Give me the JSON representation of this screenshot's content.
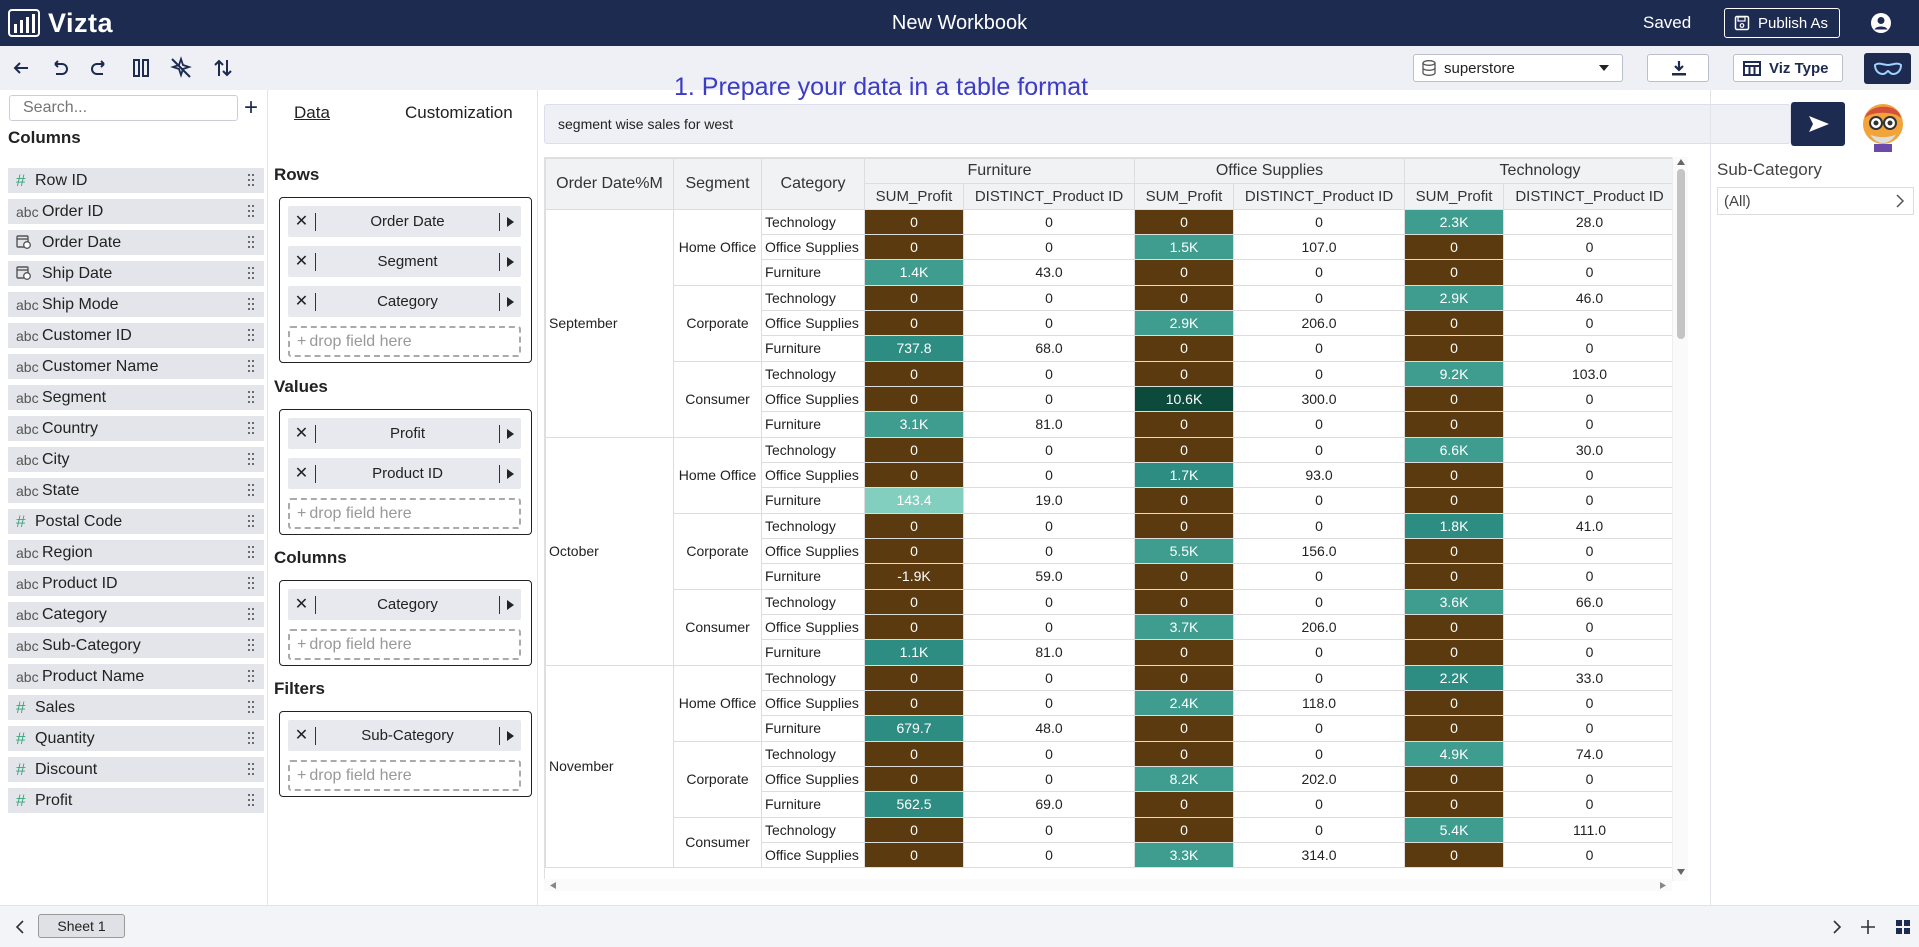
{
  "app": {
    "name": "Vizta",
    "workbook_title": "New Workbook",
    "save_status": "Saved",
    "publish_label": "Publish As"
  },
  "toolbar": {
    "datasource": "superstore",
    "viz_type_label": "Viz Type"
  },
  "colors": {
    "brand": "#1d2b50",
    "heat_negative": "#5a3a0e",
    "heat_low": "#2e8d83",
    "heat_mid": "#3f9d90",
    "heat_high": "#0c4a3c",
    "heat_light": "#82cfc0"
  },
  "left": {
    "search_placeholder": "Search...",
    "columns_title": "Columns",
    "fields": [
      {
        "type": "#",
        "name": "Row ID"
      },
      {
        "type": "abc",
        "name": "Order ID"
      },
      {
        "type": "date",
        "name": "Order Date"
      },
      {
        "type": "date",
        "name": "Ship Date"
      },
      {
        "type": "abc",
        "name": "Ship Mode"
      },
      {
        "type": "abc",
        "name": "Customer ID"
      },
      {
        "type": "abc",
        "name": "Customer Name"
      },
      {
        "type": "abc",
        "name": "Segment"
      },
      {
        "type": "abc",
        "name": "Country"
      },
      {
        "type": "abc",
        "name": "City"
      },
      {
        "type": "abc",
        "name": "State"
      },
      {
        "type": "#",
        "name": "Postal Code"
      },
      {
        "type": "abc",
        "name": "Region"
      },
      {
        "type": "abc",
        "name": "Product ID"
      },
      {
        "type": "abc",
        "name": "Category"
      },
      {
        "type": "abc",
        "name": "Sub-Category"
      },
      {
        "type": "abc",
        "name": "Product Name"
      },
      {
        "type": "#",
        "name": "Sales"
      },
      {
        "type": "#",
        "name": "Quantity"
      },
      {
        "type": "#",
        "name": "Discount"
      },
      {
        "type": "#",
        "name": "Profit"
      }
    ]
  },
  "config": {
    "tab_data": "Data",
    "tab_customization": "Customization",
    "rows_title": "Rows",
    "rows": [
      "Order Date",
      "Segment",
      "Category"
    ],
    "values_title": "Values",
    "values": [
      "Profit",
      "Product ID"
    ],
    "columns_title": "Columns",
    "columns": [
      "Category"
    ],
    "filters_title": "Filters",
    "filters": [
      "Sub-Category"
    ],
    "drop_placeholder": "drop field here",
    "pill_x": "✕"
  },
  "main": {
    "instruction": "1. Prepare your data in a table format",
    "query": "segment wise sales for west"
  },
  "table": {
    "row_headers": [
      "Order Date%M",
      "Segment",
      "Category"
    ],
    "column_groups": [
      "Furniture",
      "Office Supplies",
      "Technology"
    ],
    "value_headers": [
      "SUM_Profit",
      "DISTINCT_Product ID"
    ],
    "months": [
      {
        "name": "September",
        "segments": [
          {
            "name": "Home Office",
            "rows": [
              {
                "cat": "Technology",
                "v": [
                  "0",
                  "0",
                  "0",
                  "0",
                  "2.3K",
                  "28.0"
                ],
                "h": [
                  "n",
                  "",
                  "n",
                  "",
                  "l",
                  ""
                ]
              },
              {
                "cat": "Office Supplies",
                "v": [
                  "0",
                  "0",
                  "1.5K",
                  "107.0",
                  "0",
                  "0"
                ],
                "h": [
                  "n",
                  "",
                  "l",
                  "",
                  "n",
                  ""
                ]
              },
              {
                "cat": "Furniture",
                "v": [
                  "1.4K",
                  "43.0",
                  "0",
                  "0",
                  "0",
                  "0"
                ],
                "h": [
                  "l",
                  "",
                  "n",
                  "",
                  "n",
                  ""
                ]
              }
            ]
          },
          {
            "name": "Corporate",
            "rows": [
              {
                "cat": "Technology",
                "v": [
                  "0",
                  "0",
                  "0",
                  "0",
                  "2.9K",
                  "46.0"
                ],
                "h": [
                  "n",
                  "",
                  "n",
                  "",
                  "l",
                  ""
                ]
              },
              {
                "cat": "Office Supplies",
                "v": [
                  "0",
                  "0",
                  "2.9K",
                  "206.0",
                  "0",
                  "0"
                ],
                "h": [
                  "n",
                  "",
                  "l",
                  "",
                  "n",
                  ""
                ]
              },
              {
                "cat": "Furniture",
                "v": [
                  "737.8",
                  "68.0",
                  "0",
                  "0",
                  "0",
                  "0"
                ],
                "h": [
                  "m",
                  "",
                  "n",
                  "",
                  "n",
                  ""
                ]
              }
            ]
          },
          {
            "name": "Consumer",
            "rows": [
              {
                "cat": "Technology",
                "v": [
                  "0",
                  "0",
                  "0",
                  "0",
                  "9.2K",
                  "103.0"
                ],
                "h": [
                  "n",
                  "",
                  "n",
                  "",
                  "l",
                  ""
                ]
              },
              {
                "cat": "Office Supplies",
                "v": [
                  "0",
                  "0",
                  "10.6K",
                  "300.0",
                  "0",
                  "0"
                ],
                "h": [
                  "n",
                  "",
                  "d",
                  "",
                  "n",
                  ""
                ]
              },
              {
                "cat": "Furniture",
                "v": [
                  "3.1K",
                  "81.0",
                  "0",
                  "0",
                  "0",
                  "0"
                ],
                "h": [
                  "l",
                  "",
                  "n",
                  "",
                  "n",
                  ""
                ]
              }
            ]
          }
        ]
      },
      {
        "name": "October",
        "segments": [
          {
            "name": "Home Office",
            "rows": [
              {
                "cat": "Technology",
                "v": [
                  "0",
                  "0",
                  "0",
                  "0",
                  "6.6K",
                  "30.0"
                ],
                "h": [
                  "n",
                  "",
                  "n",
                  "",
                  "l",
                  ""
                ]
              },
              {
                "cat": "Office Supplies",
                "v": [
                  "0",
                  "0",
                  "1.7K",
                  "93.0",
                  "0",
                  "0"
                ],
                "h": [
                  "n",
                  "",
                  "m",
                  "",
                  "n",
                  ""
                ]
              },
              {
                "cat": "Furniture",
                "v": [
                  "143.4",
                  "19.0",
                  "0",
                  "0",
                  "0",
                  "0"
                ],
                "h": [
                  "p",
                  "",
                  "n",
                  "",
                  "n",
                  ""
                ]
              }
            ]
          },
          {
            "name": "Corporate",
            "rows": [
              {
                "cat": "Technology",
                "v": [
                  "0",
                  "0",
                  "0",
                  "0",
                  "1.8K",
                  "41.0"
                ],
                "h": [
                  "n",
                  "",
                  "n",
                  "",
                  "m",
                  ""
                ]
              },
              {
                "cat": "Office Supplies",
                "v": [
                  "0",
                  "0",
                  "5.5K",
                  "156.0",
                  "0",
                  "0"
                ],
                "h": [
                  "n",
                  "",
                  "l",
                  "",
                  "n",
                  ""
                ]
              },
              {
                "cat": "Furniture",
                "v": [
                  "-1.9K",
                  "59.0",
                  "0",
                  "0",
                  "0",
                  "0"
                ],
                "h": [
                  "n",
                  "",
                  "n",
                  "",
                  "n",
                  ""
                ]
              }
            ]
          },
          {
            "name": "Consumer",
            "rows": [
              {
                "cat": "Technology",
                "v": [
                  "0",
                  "0",
                  "0",
                  "0",
                  "3.6K",
                  "66.0"
                ],
                "h": [
                  "n",
                  "",
                  "n",
                  "",
                  "l",
                  ""
                ]
              },
              {
                "cat": "Office Supplies",
                "v": [
                  "0",
                  "0",
                  "3.7K",
                  "206.0",
                  "0",
                  "0"
                ],
                "h": [
                  "n",
                  "",
                  "l",
                  "",
                  "n",
                  ""
                ]
              },
              {
                "cat": "Furniture",
                "v": [
                  "1.1K",
                  "81.0",
                  "0",
                  "0",
                  "0",
                  "0"
                ],
                "h": [
                  "m",
                  "",
                  "n",
                  "",
                  "n",
                  ""
                ]
              }
            ]
          }
        ]
      },
      {
        "name": "November",
        "segments": [
          {
            "name": "Home Office",
            "rows": [
              {
                "cat": "Technology",
                "v": [
                  "0",
                  "0",
                  "0",
                  "0",
                  "2.2K",
                  "33.0"
                ],
                "h": [
                  "n",
                  "",
                  "n",
                  "",
                  "m",
                  ""
                ]
              },
              {
                "cat": "Office Supplies",
                "v": [
                  "0",
                  "0",
                  "2.4K",
                  "118.0",
                  "0",
                  "0"
                ],
                "h": [
                  "n",
                  "",
                  "l",
                  "",
                  "n",
                  ""
                ]
              },
              {
                "cat": "Furniture",
                "v": [
                  "679.7",
                  "48.0",
                  "0",
                  "0",
                  "0",
                  "0"
                ],
                "h": [
                  "m",
                  "",
                  "n",
                  "",
                  "n",
                  ""
                ]
              }
            ]
          },
          {
            "name": "Corporate",
            "rows": [
              {
                "cat": "Technology",
                "v": [
                  "0",
                  "0",
                  "0",
                  "0",
                  "4.9K",
                  "74.0"
                ],
                "h": [
                  "n",
                  "",
                  "n",
                  "",
                  "l",
                  ""
                ]
              },
              {
                "cat": "Office Supplies",
                "v": [
                  "0",
                  "0",
                  "8.2K",
                  "202.0",
                  "0",
                  "0"
                ],
                "h": [
                  "n",
                  "",
                  "l",
                  "",
                  "n",
                  ""
                ]
              },
              {
                "cat": "Furniture",
                "v": [
                  "562.5",
                  "69.0",
                  "0",
                  "0",
                  "0",
                  "0"
                ],
                "h": [
                  "m",
                  "",
                  "n",
                  "",
                  "n",
                  ""
                ]
              }
            ]
          },
          {
            "name": "Consumer",
            "rows": [
              {
                "cat": "Technology",
                "v": [
                  "0",
                  "0",
                  "0",
                  "0",
                  "5.4K",
                  "111.0"
                ],
                "h": [
                  "n",
                  "",
                  "n",
                  "",
                  "l",
                  ""
                ]
              },
              {
                "cat": "Office Supplies",
                "v": [
                  "0",
                  "0",
                  "3.3K",
                  "314.0",
                  "0",
                  "0"
                ],
                "h": [
                  "n",
                  "",
                  "l",
                  "",
                  "n",
                  ""
                ]
              }
            ]
          }
        ]
      }
    ]
  },
  "filter": {
    "title": "Sub-Category",
    "value": "(All)"
  },
  "bottom": {
    "sheet_label": "Sheet 1"
  }
}
